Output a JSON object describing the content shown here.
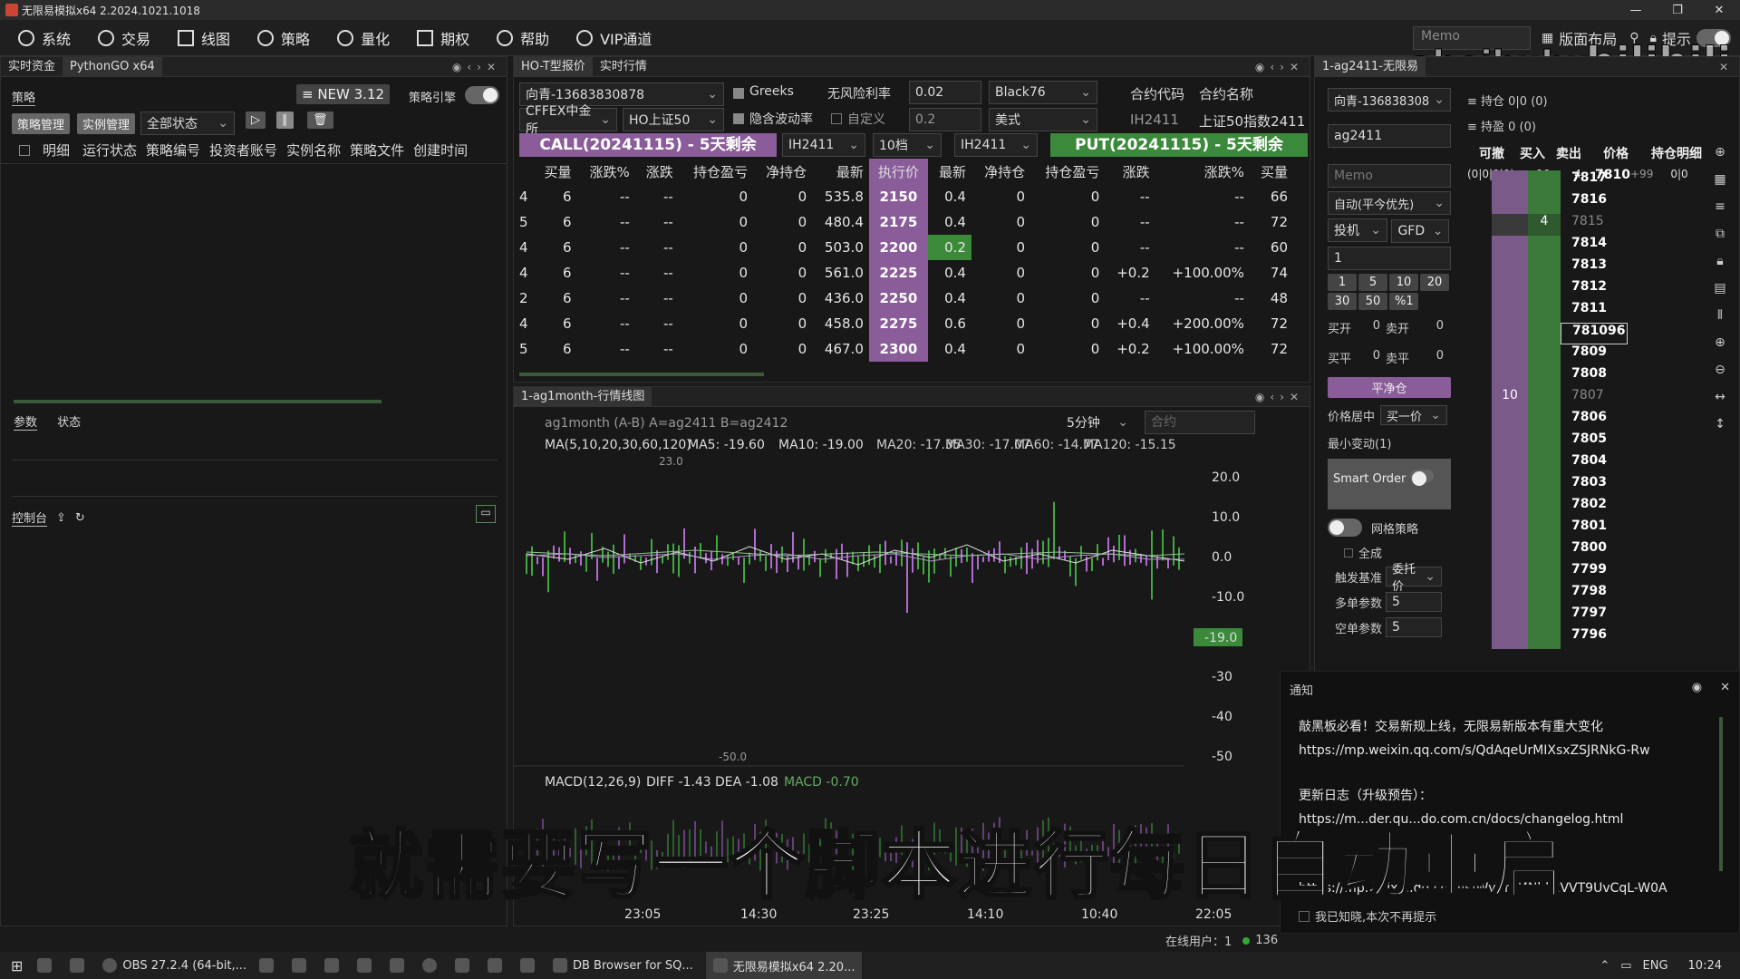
{
  "window": {
    "title": "无限易模拟x64  2.2024.1021.1018"
  },
  "menu": [
    "系统",
    "交易",
    "线图",
    "策略",
    "量化",
    "期权",
    "帮助",
    "VIP通道"
  ],
  "topright": {
    "memo": "Memo",
    "layout": "版面布局",
    "hint": "提示"
  },
  "watermark": "aheihuhu",
  "left": {
    "tabs": [
      "实时资金",
      "PythonGO x64"
    ],
    "strategy_label": "策略",
    "new_badge": "≡ NEW 3.12",
    "engine_label": "策略引擎",
    "btn_manage": "策略管理",
    "btn_instance": "实例管理",
    "status_filter": "全部状态",
    "columns": [
      "明细",
      "运行状态",
      "策略编号",
      "投资者账号",
      "实例名称",
      "策略文件",
      "创建时间"
    ],
    "sub_tabs": [
      "参数",
      "状态"
    ],
    "console": "控制台"
  },
  "option": {
    "tabs": [
      "HO-T型报价",
      "实时行情"
    ],
    "account": "向青-13683830878",
    "greeks": "Greeks",
    "rf_label": "无风险利率",
    "rf": "0.02",
    "model": "Black76",
    "code_label": "合约代码",
    "name_label": "合约名称",
    "exchange": "CFFEX中金所",
    "underlying": "HO上证50",
    "iv_label": "隐含波动率",
    "custom_label": "自定义",
    "iv": "0.2",
    "style": "美式",
    "code": "IH2411",
    "name": "上证50指数2411",
    "call_title": "CALL(20241115) - 5天剩余",
    "put_title": "PUT(20241115) - 5天剩余",
    "call_sel": "IH2411",
    "depth": "10档",
    "put_sel": "IH2411",
    "headers": [
      "买量",
      "涨跌%",
      "涨跌",
      "持仓盈亏",
      "净持仓",
      "最新",
      "执行价",
      "最新",
      "净持仓",
      "持仓盈亏",
      "涨跌",
      "涨跌%",
      "买量"
    ],
    "rows": [
      [
        "4",
        "6",
        "--",
        "--",
        "0",
        "0",
        "535.8",
        "2150",
        "0.4",
        "0",
        "0",
        "--",
        "--",
        "66"
      ],
      [
        "5",
        "6",
        "--",
        "--",
        "0",
        "0",
        "480.4",
        "2175",
        "0.4",
        "0",
        "0",
        "--",
        "--",
        "72"
      ],
      [
        "4",
        "6",
        "--",
        "--",
        "0",
        "0",
        "503.0",
        "2200",
        "0.2",
        "0",
        "0",
        "--",
        "--",
        "60"
      ],
      [
        "4",
        "6",
        "--",
        "--",
        "0",
        "0",
        "561.0",
        "2225",
        "0.4",
        "0",
        "0",
        "+0.2",
        "+100.00%",
        "74"
      ],
      [
        "2",
        "6",
        "--",
        "--",
        "0",
        "0",
        "436.0",
        "2250",
        "0.4",
        "0",
        "0",
        "--",
        "--",
        "48"
      ],
      [
        "4",
        "6",
        "--",
        "--",
        "0",
        "0",
        "458.0",
        "2275",
        "0.6",
        "0",
        "0",
        "+0.4",
        "+200.00%",
        "72"
      ],
      [
        "5",
        "6",
        "--",
        "--",
        "0",
        "0",
        "467.0",
        "2300",
        "0.4",
        "0",
        "0",
        "+0.2",
        "+100.00%",
        "72"
      ]
    ]
  },
  "chart": {
    "tab": "1-ag1month-行情线图",
    "info": "ag1month (A-B) A=ag2411 B=ag2412",
    "period": "5分钟",
    "contract_ph": "合约",
    "ma_label": "MA(5,10,20,30,60,120)",
    "ma5": "MA5: -19.60",
    "ma10": "MA10: -19.00",
    "ma20": "MA20: -17.35",
    "ma30": "MA30: -17.07",
    "ma60": "MA60: -14.77",
    "ma120": "MA120: -15.15",
    "yticks": [
      "20.0",
      "10.0",
      "0.0",
      "-10.0",
      "-19.0",
      "-30",
      "-40",
      "-50"
    ],
    "hi_label": "23.0",
    "lo_label": "-50.0",
    "macd_label": "MACD(12,26,9)",
    "diff": "DIFF -1.43",
    "dea": "DEA -1.08",
    "macd": "MACD -0.70",
    "xticks": [
      "23:05",
      "14:30",
      "23:25",
      "14:10",
      "10:40",
      "22:05"
    ]
  },
  "trade": {
    "tab": "1-ag2411-无限易",
    "account": "向青-13683830878",
    "contract": "ag2411",
    "memo": "Memo",
    "mode": "自动(平今优先)",
    "spec": "投机",
    "tif": "GFD",
    "qty": "1",
    "quick": [
      "1",
      "5",
      "10",
      "20",
      "30",
      "50",
      "%1"
    ],
    "open_buy": "买开",
    "open_buy_v": "0",
    "open_sell": "卖开",
    "open_sell_v": "0",
    "close_buy": "买平",
    "close_buy_v": "0",
    "close_sell": "卖平",
    "close_sell_v": "0",
    "flatten": "平净仓",
    "center": "价格居中",
    "center_opt": "买一价",
    "tick": "最小变动(1)",
    "smart": "Smart Order",
    "grid": "网格策略",
    "fill": "全成",
    "trigger": "触发基准",
    "trigger_opt": "委托价",
    "multi": "多单参数",
    "multi_v": "5",
    "short": "空单参数",
    "short_v": "5"
  },
  "ladder": {
    "pos": "≡ 持仓 0|0  (0)",
    "pnl": "≡ 持盈 0  (0)",
    "headers": [
      "可撤",
      "买入",
      "卖出",
      "价格",
      "持仓明细"
    ],
    "top": {
      "cancel": "(0|0|0|0)",
      "buy": "10",
      "sell": "4",
      "price": "7810",
      "chg": "+99",
      "hold": "0|0"
    },
    "rows": [
      {
        "p": "7817",
        "b": "",
        "s": ""
      },
      {
        "p": "7816",
        "b": "",
        "s": ""
      },
      {
        "p": "7815",
        "b": "",
        "s": "4"
      },
      {
        "p": "7814",
        "b": "",
        "s": ""
      },
      {
        "p": "7813",
        "b": "",
        "s": ""
      },
      {
        "p": "7812",
        "b": "",
        "s": ""
      },
      {
        "p": "7811",
        "b": "",
        "s": ""
      },
      {
        "p": "7810",
        "b": "",
        "s": "",
        "cur": "96"
      },
      {
        "p": "7809",
        "b": "",
        "s": ""
      },
      {
        "p": "7808",
        "b": "",
        "s": ""
      },
      {
        "p": "7807",
        "b": "10",
        "s": ""
      },
      {
        "p": "7806",
        "b": "",
        "s": ""
      },
      {
        "p": "7805",
        "b": "",
        "s": ""
      },
      {
        "p": "7804",
        "b": "",
        "s": ""
      },
      {
        "p": "7803",
        "b": "",
        "s": ""
      },
      {
        "p": "7802",
        "b": "",
        "s": ""
      },
      {
        "p": "7801",
        "b": "",
        "s": ""
      },
      {
        "p": "7800",
        "b": "",
        "s": ""
      },
      {
        "p": "7799",
        "b": "",
        "s": ""
      },
      {
        "p": "7798",
        "b": "",
        "s": ""
      },
      {
        "p": "7797",
        "b": "",
        "s": ""
      },
      {
        "p": "7796",
        "b": "",
        "s": ""
      }
    ]
  },
  "notice": {
    "title": "通知",
    "l1": "敲黑板必看！交易新规上线，无限易新版本有重大变化",
    "l2": "https://mp.weixin.qq.com/s/QdAqeUrMIXsxZSJRNkG-Rw",
    "l3": "更新日志（升级预告）：",
    "l4": "https://m...der.qu...do.com.cn/docs/changelog.html",
    "l5": "https://mp.weixin.qq.com/s/WvVmMNbkkVVT9UvCqL-W0A",
    "ack": "我已知晓,本次不再提示"
  },
  "status": {
    "online": "在线用户：1",
    "user": "136"
  },
  "subtitle": "就需要写一个脚本进行每日自动重启",
  "taskbar": {
    "obs": "OBS 27.2.4 (64-bit,...",
    "db": "DB Browser for SQ...",
    "app": "无限易模拟x64  2.20...",
    "lang": "ENG",
    "time": "10:24"
  }
}
